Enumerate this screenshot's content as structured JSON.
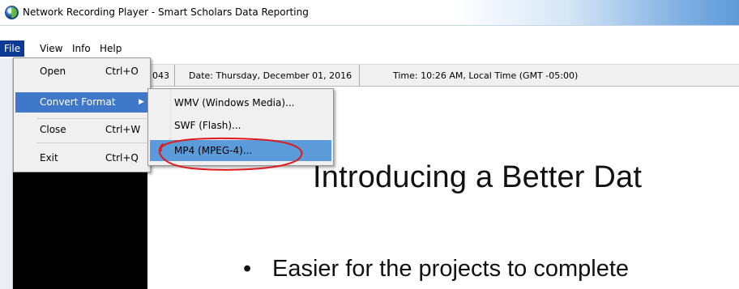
{
  "window": {
    "title": "Network Recording Player - Smart Scholars Data Reporting"
  },
  "menubar": {
    "items": [
      {
        "label": "File",
        "active": true
      },
      {
        "label": "View",
        "active": false
      },
      {
        "label": "Info",
        "active": false
      },
      {
        "label": "Help",
        "active": false
      }
    ]
  },
  "infobar": {
    "partial": "043",
    "date": "Date: Thursday, December 01, 2016",
    "time": "Time: 10:26 AM, Local Time (GMT -05:00)"
  },
  "file_menu": {
    "items": [
      {
        "label": "Open",
        "shortcut": "Ctrl+O"
      },
      {
        "label": "Convert Format",
        "shortcut": ""
      },
      {
        "label": "Close",
        "shortcut": "Ctrl+W"
      },
      {
        "label": "Exit",
        "shortcut": "Ctrl+Q"
      }
    ],
    "active_index": 1
  },
  "convert_submenu": {
    "items": [
      {
        "label": "WMV (Windows Media)..."
      },
      {
        "label": "SWF (Flash)..."
      },
      {
        "label": "MP4 (MPEG-4)..."
      }
    ],
    "highlighted_index": 2
  },
  "slide": {
    "title": "Introducing a Better Dat",
    "bullet": "Easier for the projects to complete"
  },
  "colors": {
    "menu_active": "#0a3a94",
    "dropdown_active": "#3f78c8",
    "submenu_highlight": "#5b9bd9",
    "annotation": "#e0191b"
  }
}
